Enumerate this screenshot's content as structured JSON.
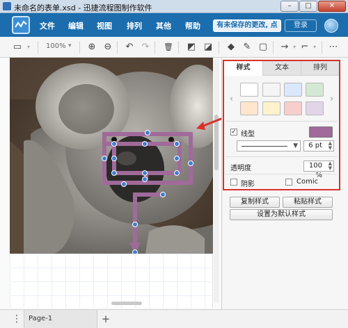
{
  "window": {
    "title": "未命名的表单.xsd - 迅捷流程图制作软件",
    "min_glyph": "–",
    "max_glyph": "□",
    "close_glyph": "✕"
  },
  "menubar": {
    "items": [
      "文件",
      "编辑",
      "视图",
      "排列",
      "其他",
      "帮助"
    ],
    "save_notice": "有未保存的更改, 点击保存",
    "login": "登录"
  },
  "toolbar": {
    "zoom": "100%",
    "glyphs": {
      "page": "▭",
      "zoom_in": "⊕",
      "zoom_out": "⊖",
      "undo": "↶",
      "redo": "↷",
      "delete": "🗑",
      "to_front": "◩",
      "to_back": "◪",
      "fill": "◆",
      "line_color": "✎",
      "shadow": "▢",
      "connector": "→",
      "waypoint": "⌐",
      "more": "⋯"
    }
  },
  "pages": {
    "more_glyph": "⋮",
    "tab": "Page-1",
    "add_glyph": "+"
  },
  "panel": {
    "tabs": [
      "样式",
      "文本",
      "排列"
    ],
    "swatches": [
      "#ffffff",
      "#f5f5f5",
      "#dae8fc",
      "#d5e8d4",
      "#ffe6cc",
      "#fff2cc",
      "#f8cecc",
      "#e1d5e7"
    ],
    "prev_glyph": "‹",
    "next_glyph": "›",
    "line_checked": "✓",
    "line_label": "线型",
    "line_color": "#a06a9a",
    "line_width": "6 pt",
    "opacity_label": "透明度",
    "opacity": "100 %",
    "shadow_label": "阴影",
    "comic_label": "Comic",
    "copy_style": "复制样式",
    "paste_style": "粘贴样式",
    "set_default": "设置为默认样式"
  }
}
